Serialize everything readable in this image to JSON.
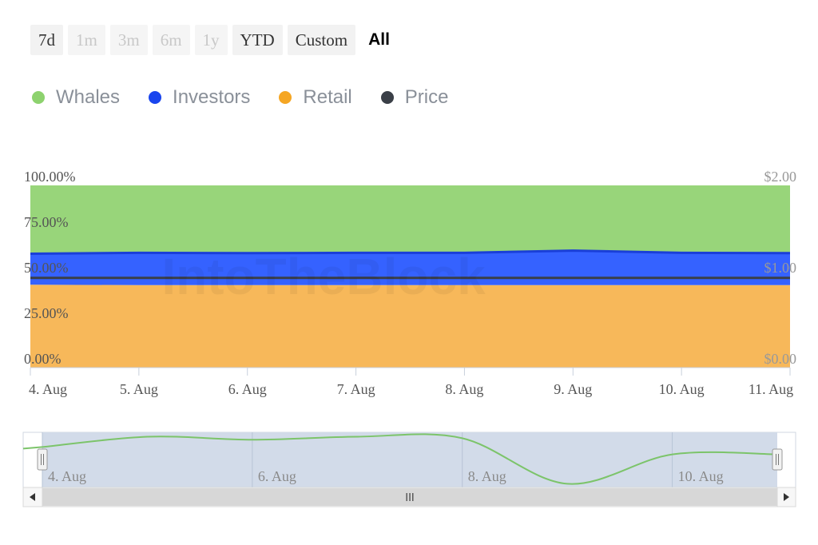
{
  "range_selector": {
    "buttons": [
      {
        "label": "7d",
        "state": "normal"
      },
      {
        "label": "1m",
        "state": "disabled"
      },
      {
        "label": "3m",
        "state": "disabled"
      },
      {
        "label": "6m",
        "state": "disabled"
      },
      {
        "label": "1y",
        "state": "disabled"
      },
      {
        "label": "YTD",
        "state": "normal"
      },
      {
        "label": "Custom",
        "state": "normal"
      },
      {
        "label": "All",
        "state": "active"
      }
    ]
  },
  "legend": [
    {
      "name": "Whales",
      "color": "#8dd26e"
    },
    {
      "name": "Investors",
      "color": "#1a45ee"
    },
    {
      "name": "Retail",
      "color": "#f5a623"
    },
    {
      "name": "Price",
      "color": "#3a3f47"
    }
  ],
  "watermark": "IntoTheBlock",
  "chart_data": {
    "type": "area",
    "x": [
      "4. Aug",
      "5. Aug",
      "6. Aug",
      "7. Aug",
      "8. Aug",
      "9. Aug",
      "10. Aug",
      "11. Aug"
    ],
    "series": [
      {
        "name": "Retail",
        "stack": "percent",
        "values": [
          45.5,
          45.3,
          45.3,
          45.3,
          45.3,
          45.3,
          45.3,
          45.3
        ]
      },
      {
        "name": "Investors",
        "stack": "percent",
        "values": [
          17.0,
          17.7,
          17.5,
          17.7,
          17.7,
          18.9,
          17.7,
          17.5
        ]
      },
      {
        "name": "Whales",
        "stack": "percent",
        "values": [
          37.5,
          37.0,
          37.2,
          37.0,
          37.0,
          35.8,
          37.0,
          37.2
        ]
      },
      {
        "name": "Price",
        "axis": "right",
        "values": [
          0.985,
          0.985,
          0.985,
          0.985,
          0.985,
          0.985,
          0.985,
          0.985
        ]
      }
    ],
    "y_left": {
      "ticks": [
        "0.00%",
        "25.00%",
        "50.00%",
        "75.00%",
        "100.00%"
      ],
      "range": [
        0,
        100
      ]
    },
    "y_right": {
      "ticks": [
        "$0.00",
        "$1.00",
        "$2.00"
      ],
      "range": [
        0,
        2
      ]
    },
    "navigator": {
      "labels": [
        "4. Aug",
        "6. Aug",
        "8. Aug",
        "10. Aug"
      ],
      "values": [
        0.85,
        0.99,
        0.95,
        0.99,
        0.97,
        0.35,
        0.75,
        0.75
      ],
      "range": [
        0.3,
        1.05
      ]
    },
    "scrollbar_grip": "III"
  }
}
